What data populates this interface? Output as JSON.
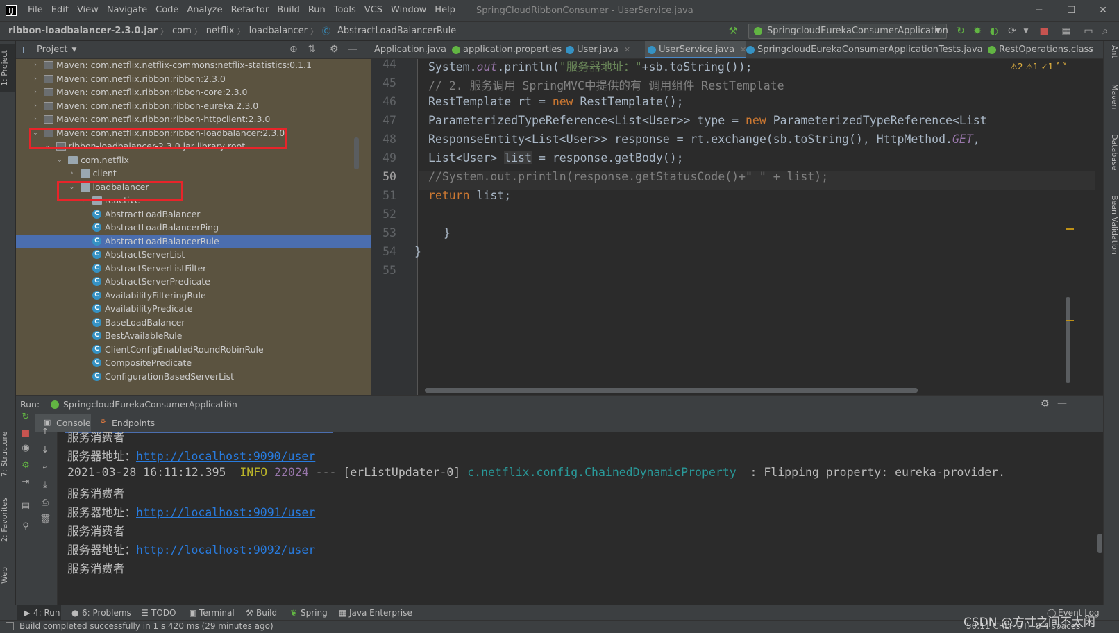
{
  "app": {
    "window_title": "SpringCloudRibbonConsumer - UserService.java",
    "menu": [
      "File",
      "Edit",
      "View",
      "Navigate",
      "Code",
      "Analyze",
      "Refactor",
      "Build",
      "Run",
      "Tools",
      "VCS",
      "Window",
      "Help"
    ],
    "window_controls": [
      "─",
      "☐",
      "✕"
    ]
  },
  "navbar": {
    "breadcrumbs": [
      "ribbon-loadbalancer-2.3.0.jar",
      "com",
      "netflix",
      "loadbalancer",
      "AbstractLoadBalancerRule"
    ],
    "run_config": "SpringcloudEurekaConsumerApplication"
  },
  "left_strip": [
    "1: Project",
    "7: Structure",
    "2: Favorites",
    "Web"
  ],
  "right_strip": [
    "Ant",
    "Maven",
    "Database",
    "Bean Validation"
  ],
  "project": {
    "title": "Project",
    "tree": [
      {
        "label": "Maven: com.netflix.netflix-commons:netflix-statistics:0.1.1",
        "depth": 0,
        "arrow": "›",
        "icon": "lib"
      },
      {
        "label": "Maven: com.netflix.ribbon:ribbon:2.3.0",
        "depth": 0,
        "arrow": "›",
        "icon": "lib"
      },
      {
        "label": "Maven: com.netflix.ribbon:ribbon-core:2.3.0",
        "depth": 0,
        "arrow": "›",
        "icon": "lib"
      },
      {
        "label": "Maven: com.netflix.ribbon:ribbon-eureka:2.3.0",
        "depth": 0,
        "arrow": "›",
        "icon": "lib"
      },
      {
        "label": "Maven: com.netflix.ribbon:ribbon-httpclient:2.3.0",
        "depth": 0,
        "arrow": "›",
        "icon": "lib"
      },
      {
        "label": "Maven: com.netflix.ribbon:ribbon-loadbalancer:2.3.0",
        "depth": 0,
        "arrow": "⌄",
        "icon": "lib"
      },
      {
        "label": "ribbon-loadbalancer-2.3.0.jar  library root",
        "depth": 1,
        "arrow": "⌄",
        "icon": "lib"
      },
      {
        "label": "com.netflix",
        "depth": 2,
        "arrow": "⌄",
        "icon": "folder"
      },
      {
        "label": "client",
        "depth": 3,
        "arrow": "›",
        "icon": "folder"
      },
      {
        "label": "loadbalancer",
        "depth": 3,
        "arrow": "⌄",
        "icon": "folder"
      },
      {
        "label": "reactive",
        "depth": 4,
        "arrow": "›",
        "icon": "folder"
      },
      {
        "label": "AbstractLoadBalancer",
        "depth": 4,
        "arrow": "",
        "icon": "class"
      },
      {
        "label": "AbstractLoadBalancerPing",
        "depth": 4,
        "arrow": "",
        "icon": "class"
      },
      {
        "label": "AbstractLoadBalancerRule",
        "depth": 4,
        "arrow": "",
        "icon": "class",
        "selected": true
      },
      {
        "label": "AbstractServerList",
        "depth": 4,
        "arrow": "",
        "icon": "class"
      },
      {
        "label": "AbstractServerListFilter",
        "depth": 4,
        "arrow": "",
        "icon": "class"
      },
      {
        "label": "AbstractServerPredicate",
        "depth": 4,
        "arrow": "",
        "icon": "class"
      },
      {
        "label": "AvailabilityFilteringRule",
        "depth": 4,
        "arrow": "",
        "icon": "class"
      },
      {
        "label": "AvailabilityPredicate",
        "depth": 4,
        "arrow": "",
        "icon": "class"
      },
      {
        "label": "BaseLoadBalancer",
        "depth": 4,
        "arrow": "",
        "icon": "class"
      },
      {
        "label": "BestAvailableRule",
        "depth": 4,
        "arrow": "",
        "icon": "class"
      },
      {
        "label": "ClientConfigEnabledRoundRobinRule",
        "depth": 4,
        "arrow": "",
        "icon": "class"
      },
      {
        "label": "CompositePredicate",
        "depth": 4,
        "arrow": "",
        "icon": "class"
      },
      {
        "label": "ConfigurationBasedServerList",
        "depth": 4,
        "arrow": "",
        "icon": "class"
      }
    ]
  },
  "editor": {
    "tabs": [
      {
        "label": "Application.java",
        "active": false
      },
      {
        "label": "application.properties",
        "active": false
      },
      {
        "label": "User.java",
        "active": false
      },
      {
        "label": "UserService.java",
        "active": true
      },
      {
        "label": "SpringcloudEurekaConsumerApplicationTests.java",
        "active": false
      },
      {
        "label": "RestOperations.class",
        "active": false
      }
    ],
    "inspections": "⚠2  ⚠1  ✓1  ˄  ˅",
    "line_numbers": [
      "44",
      "45",
      "46",
      "47",
      "48",
      "49",
      "50",
      "51",
      "52",
      "53",
      "54",
      "55"
    ],
    "current_line": "50",
    "code": {
      "l44a": "System.",
      "l44b": "out",
      "l44c": ".println(",
      "l44d": "\"服务器地址：\"",
      "l44e": "+sb.toString());",
      "l45": "// 2. 服务调用 SpringMVC中提供的有 调用组件 RestTemplate",
      "l46a": "RestTemplate rt = ",
      "l46b": "new",
      "l46c": " RestTemplate();",
      "l47a": "ParameterizedTypeReference<List<User>> type = ",
      "l47b": "new",
      "l47c": " ParameterizedTypeReference<List",
      "l48a": "ResponseEntity<List<User>> response = rt.exchange(sb.toString(), HttpMethod.",
      "l48b": "GET",
      "l48c": ",",
      "l49a": "List<User> ",
      "l49b": "list",
      "l49c": " = response.getBody();",
      "l50": "//System.out.println(response.getStatusCode()+\" \" + list);",
      "l51a": "return",
      "l51b": " list;",
      "l53": "}",
      "l54": "}"
    }
  },
  "run": {
    "label": "Run:",
    "config_tab": "SpringcloudEurekaConsumerApplication",
    "tabs": [
      "Console",
      "Endpoints"
    ],
    "console": {
      "c1": "服务消费者",
      "c2a": "服务器地址：",
      "c2b": "http://localhost:9090/user",
      "c3a": "2021-03-28 16:11:12.395  ",
      "c3b": "INFO",
      "c3c": " 22024",
      "c3d": " --- [erListUpdater-0] ",
      "c3e": "c.netflix.config.ChainedDynamicProperty",
      "c3f": "  : Flipping property: eureka-provider.",
      "c4": "服务消费者",
      "c5a": "服务器地址：",
      "c5b": "http://localhost:9091/user",
      "c6": "服务消费者",
      "c7a": "服务器地址：",
      "c7b": "http://localhost:9092/user",
      "c8": "服务消费者"
    }
  },
  "bottom_tools": [
    "4: Run",
    "6: Problems",
    "TODO",
    "Terminal",
    "Build",
    "Spring",
    "Java Enterprise",
    "Event Log"
  ],
  "status": {
    "message": "Build completed successfully in 1 s 420 ms (29 minutes ago)",
    "right": "50:11  CRLF  UTF-8  4 spaces"
  },
  "watermark": "CSDN @方寸之间不太闲",
  "colors": {
    "selection": "#4b6eaf",
    "highlight_box": "#e8242a",
    "link": "#287bde",
    "keyword": "#cc7832"
  }
}
